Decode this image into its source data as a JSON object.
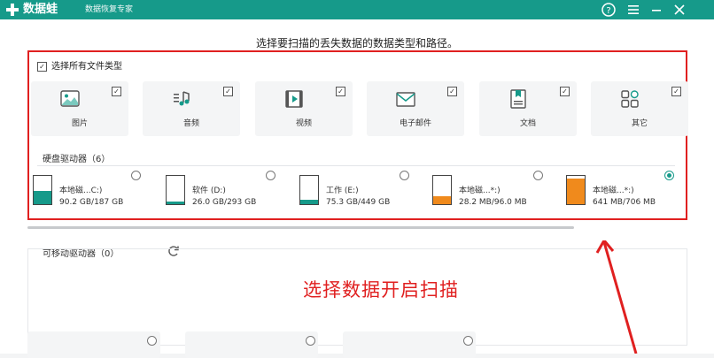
{
  "app": {
    "name": "数据蛙",
    "subtitle": "数据恢复专家"
  },
  "titlebar_buttons": [
    "help-icon",
    "menu-icon",
    "minimize-icon",
    "close-icon"
  ],
  "prompt": "选择要扫描的丢失数据的数据类型和路径。",
  "select_all": {
    "label": "选择所有文件类型",
    "checked": true
  },
  "file_types": [
    {
      "label": "图片",
      "icon": "image-icon",
      "checked": true
    },
    {
      "label": "音频",
      "icon": "audio-icon",
      "checked": true
    },
    {
      "label": "视频",
      "icon": "video-icon",
      "checked": true
    },
    {
      "label": "电子邮件",
      "icon": "email-icon",
      "checked": true
    },
    {
      "label": "文档",
      "icon": "document-icon",
      "checked": true
    },
    {
      "label": "其它",
      "icon": "other-icon",
      "checked": true
    }
  ],
  "hard_drives": {
    "title": "硬盘驱动器（6）",
    "items": [
      {
        "name": "本地磁...C:)",
        "size": "90.2 GB/187 GB",
        "fill": 0.48,
        "color": "#169a8a",
        "selected": false
      },
      {
        "name": "软件 (D:)",
        "size": "26.0 GB/293 GB",
        "fill": 0.09,
        "color": "#169a8a",
        "selected": false
      },
      {
        "name": "工作 (E:)",
        "size": "75.3 GB/449 GB",
        "fill": 0.17,
        "color": "#169a8a",
        "selected": false
      },
      {
        "name": "本地磁...*:)",
        "size": "28.2 MB/96.0 MB",
        "fill": 0.29,
        "color": "#f08a1c",
        "selected": false
      },
      {
        "name": "本地磁...*:)",
        "size": "641 MB/706 MB",
        "fill": 0.91,
        "color": "#f08a1c",
        "selected": true
      }
    ]
  },
  "removable": {
    "title": "可移动驱动器（0）"
  },
  "annotation": "选择数据开启扫描",
  "colors": {
    "brand": "#169a8a",
    "highlight": "#e02020",
    "drive_alt": "#f08a1c"
  }
}
